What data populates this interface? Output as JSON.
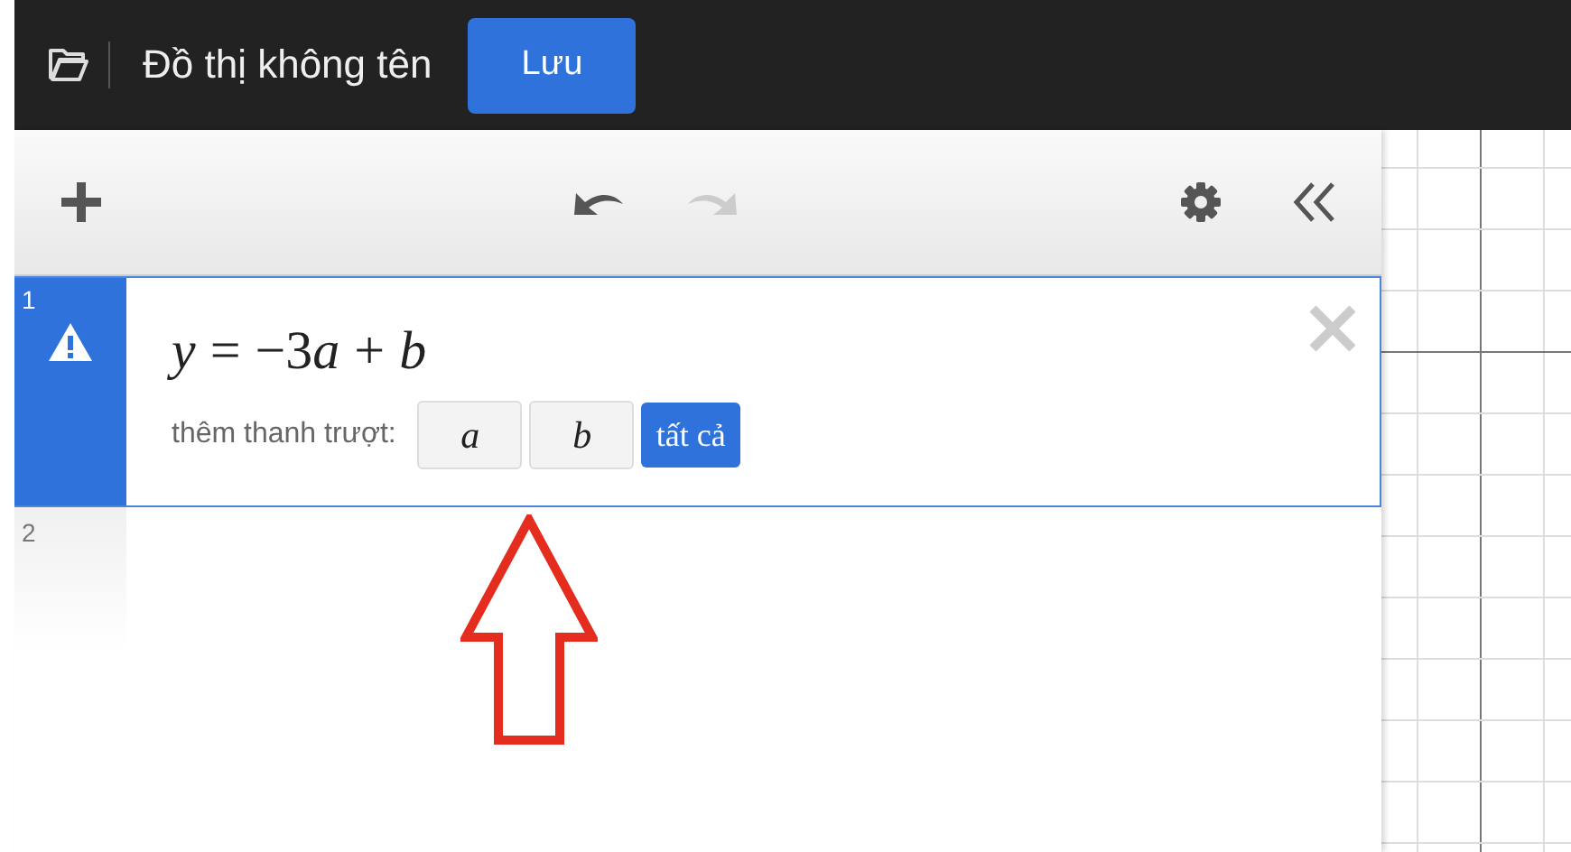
{
  "header": {
    "title": "Đồ thị không tên",
    "save_button": "Lưu"
  },
  "expressions": [
    {
      "number": "1",
      "selected": true,
      "warning": true,
      "formula": [
        {
          "kind": "variable",
          "text": "y"
        },
        {
          "kind": "operator",
          "text": "="
        },
        {
          "kind": "number",
          "text": "−3"
        },
        {
          "kind": "variable",
          "text": "a"
        },
        {
          "kind": "operator",
          "text": "+"
        },
        {
          "kind": "variable",
          "text": "b"
        }
      ],
      "slider_label": "thêm thanh trượt:",
      "slider_buttons": [
        "*a*",
        "*b*"
      ],
      "all_button": "tất cả"
    },
    {
      "number": "2",
      "selected": false,
      "warning": false
    }
  ]
}
